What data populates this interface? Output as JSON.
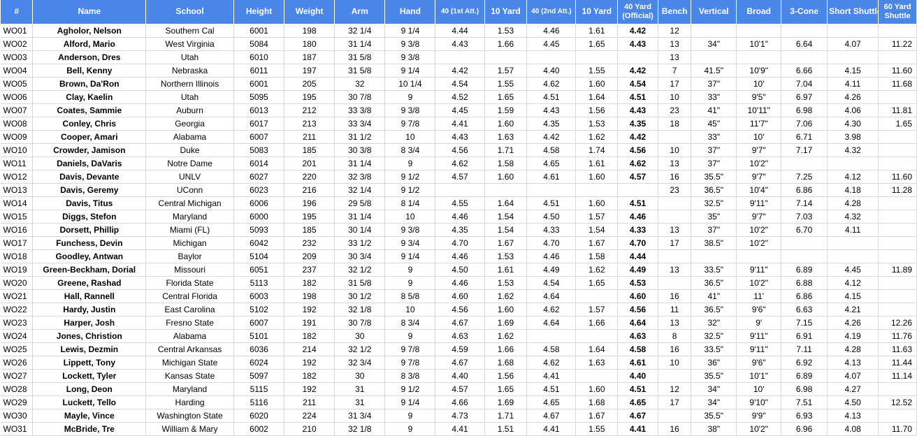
{
  "columns": [
    "#",
    "Name",
    "School",
    "Height",
    "Weight",
    "Arm",
    "Hand",
    "40 (1st Att.)",
    "10 Yard",
    "40 (2nd Att.)",
    "10 Yard",
    "40 Yard (Official)",
    "Bench",
    "Vertical",
    "Broad",
    "3-Cone",
    "Short Shuttle",
    "60 Yard Shuttle"
  ],
  "rows": [
    [
      "WO01",
      "Agholor, Nelson",
      "Southern Cal",
      "6001",
      "198",
      "32 1/4",
      "9 1/4",
      "4.44",
      "1.53",
      "4.46",
      "1.61",
      "4.42",
      "12",
      "",
      "",
      "",
      "",
      ""
    ],
    [
      "WO02",
      "Alford, Mario",
      "West Virginia",
      "5084",
      "180",
      "31 1/4",
      "9 3/8",
      "4.43",
      "1.66",
      "4.45",
      "1.65",
      "4.43",
      "13",
      "34\"",
      "10'1\"",
      "6.64",
      "4.07",
      "11.22"
    ],
    [
      "WO03",
      "Anderson, Dres",
      "Utah",
      "6010",
      "187",
      "31 5/8",
      "9 3/8",
      "",
      "",
      "",
      "",
      "",
      "13",
      "",
      "",
      "",
      "",
      ""
    ],
    [
      "WO04",
      "Bell, Kenny",
      "Nebraska",
      "6011",
      "197",
      "31 5/8",
      "9 1/4",
      "4.42",
      "1.57",
      "4.40",
      "1.55",
      "4.42",
      "7",
      "41.5\"",
      "10'9\"",
      "6.66",
      "4.15",
      "11.60"
    ],
    [
      "WO05",
      "Brown, Da'Ron",
      "Northern Illinois",
      "6001",
      "205",
      "32",
      "10 1/4",
      "4.54",
      "1.55",
      "4.62",
      "1.60",
      "4.54",
      "17",
      "37\"",
      "10'",
      "7.04",
      "4.11",
      "11.68"
    ],
    [
      "WO06",
      "Clay, Kaelin",
      "Utah",
      "5095",
      "195",
      "30 7/8",
      "9",
      "4.52",
      "1.65",
      "4.51",
      "1.64",
      "4.51",
      "10",
      "33\"",
      "9'5\"",
      "6.97",
      "4.26",
      ""
    ],
    [
      "WO07",
      "Coates, Sammie",
      "Auburn",
      "6013",
      "212",
      "33 3/8",
      "9 3/8",
      "4.45",
      "1.59",
      "4.43",
      "1.56",
      "4.43",
      "23",
      "41\"",
      "10'11\"",
      "6.98",
      "4.06",
      "11.81"
    ],
    [
      "WO08",
      "Conley, Chris",
      "Georgia",
      "6017",
      "213",
      "33 3/4",
      "9 7/8",
      "4.41",
      "1.60",
      "4.35",
      "1.53",
      "4.35",
      "18",
      "45\"",
      "11'7\"",
      "7.06",
      "4.30",
      "1.65"
    ],
    [
      "WO09",
      "Cooper, Amari",
      "Alabama",
      "6007",
      "211",
      "31 1/2",
      "10",
      "4.43",
      "1.63",
      "4.42",
      "1.62",
      "4.42",
      "",
      "33\"",
      "10'",
      "6.71",
      "3.98",
      ""
    ],
    [
      "WO10",
      "Crowder, Jamison",
      "Duke",
      "5083",
      "185",
      "30 3/8",
      "8 3/4",
      "4.56",
      "1.71",
      "4.58",
      "1.74",
      "4.56",
      "10",
      "37\"",
      "9'7\"",
      "7.17",
      "4.32",
      ""
    ],
    [
      "WO11",
      "Daniels, DaVaris",
      "Notre Dame",
      "6014",
      "201",
      "31 1/4",
      "9",
      "4.62",
      "1.58",
      "4.65",
      "1.61",
      "4.62",
      "13",
      "37\"",
      "10'2\"",
      "",
      "",
      ""
    ],
    [
      "WO12",
      "Davis, Devante",
      "UNLV",
      "6027",
      "220",
      "32 3/8",
      "9 1/2",
      "4.57",
      "1.60",
      "4.61",
      "1.60",
      "4.57",
      "16",
      "35.5\"",
      "9'7\"",
      "7.25",
      "4.12",
      "11.60"
    ],
    [
      "WO13",
      "Davis, Geremy",
      "UConn",
      "6023",
      "216",
      "32 1/4",
      "9 1/2",
      "",
      "",
      "",
      "",
      "",
      "23",
      "36.5\"",
      "10'4\"",
      "6.86",
      "4.18",
      "11.28"
    ],
    [
      "WO14",
      "Davis, Titus",
      "Central Michigan",
      "6006",
      "196",
      "29 5/8",
      "8 1/4",
      "4.55",
      "1.64",
      "4.51",
      "1.60",
      "4.51",
      "",
      "32.5\"",
      "9'11\"",
      "7.14",
      "4.28",
      ""
    ],
    [
      "WO15",
      "Diggs, Stefon",
      "Maryland",
      "6000",
      "195",
      "31 1/4",
      "10",
      "4.46",
      "1.54",
      "4.50",
      "1.57",
      "4.46",
      "",
      "35\"",
      "9'7\"",
      "7.03",
      "4.32",
      ""
    ],
    [
      "WO16",
      "Dorsett, Phillip",
      "Miami (FL)",
      "5093",
      "185",
      "30 1/4",
      "9 3/8",
      "4.35",
      "1.54",
      "4.33",
      "1.54",
      "4.33",
      "13",
      "37\"",
      "10'2\"",
      "6.70",
      "4.11",
      ""
    ],
    [
      "WO17",
      "Funchess, Devin",
      "Michigan",
      "6042",
      "232",
      "33 1/2",
      "9 3/4",
      "4.70",
      "1.67",
      "4.70",
      "1.67",
      "4.70",
      "17",
      "38.5\"",
      "10'2\"",
      "",
      "",
      ""
    ],
    [
      "WO18",
      "Goodley, Antwan",
      "Baylor",
      "5104",
      "209",
      "30 3/4",
      "9 1/4",
      "4.46",
      "1.53",
      "4.46",
      "1.58",
      "4.44",
      "",
      "",
      "",
      "",
      "",
      ""
    ],
    [
      "WO19",
      "Green-Beckham, Dorial",
      "Missouri",
      "6051",
      "237",
      "32 1/2",
      "9",
      "4.50",
      "1.61",
      "4.49",
      "1.62",
      "4.49",
      "13",
      "33.5\"",
      "9'11\"",
      "6.89",
      "4.45",
      "11.89"
    ],
    [
      "WO20",
      "Greene, Rashad",
      "Florida State",
      "5113",
      "182",
      "31 5/8",
      "9",
      "4.46",
      "1.53",
      "4.54",
      "1.65",
      "4.53",
      "",
      "36.5\"",
      "10'2\"",
      "6.88",
      "4.12",
      ""
    ],
    [
      "WO21",
      "Hall, Rannell",
      "Central Florida",
      "6003",
      "198",
      "30 1/2",
      "8 5/8",
      "4.60",
      "1.62",
      "4.64",
      "",
      "4.60",
      "16",
      "41\"",
      "11'",
      "6.86",
      "4.15",
      ""
    ],
    [
      "WO22",
      "Hardy, Justin",
      "East Carolina",
      "5102",
      "192",
      "32 1/8",
      "10",
      "4.56",
      "1.60",
      "4.62",
      "1.57",
      "4.56",
      "11",
      "36.5\"",
      "9'6\"",
      "6.63",
      "4.21",
      ""
    ],
    [
      "WO23",
      "Harper, Josh",
      "Fresno State",
      "6007",
      "191",
      "30 7/8",
      "8 3/4",
      "4.67",
      "1.69",
      "4.64",
      "1.66",
      "4.64",
      "13",
      "32\"",
      "9'",
      "7.15",
      "4.26",
      "12.26"
    ],
    [
      "WO24",
      "Jones, Christion",
      "Alabama",
      "5101",
      "182",
      "30",
      "9",
      "4.63",
      "1.62",
      "",
      "",
      "4.63",
      "8",
      "32.5\"",
      "9'11\"",
      "6.91",
      "4.19",
      "11.76"
    ],
    [
      "WO25",
      "Lewis, Dezmin",
      "Central Arkansas",
      "6036",
      "214",
      "32 1/2",
      "9 7/8",
      "4.59",
      "1.66",
      "4.58",
      "1.64",
      "4.58",
      "16",
      "33.5\"",
      "9'11\"",
      "7.11",
      "4.28",
      "11.63"
    ],
    [
      "WO26",
      "Lippett, Tony",
      "Michigan State",
      "6024",
      "192",
      "32 3/4",
      "9 7/8",
      "4.67",
      "1.68",
      "4.62",
      "1.63",
      "4.61",
      "10",
      "36\"",
      "9'6\"",
      "6.92",
      "4.13",
      "11.44"
    ],
    [
      "WO27",
      "Lockett, Tyler",
      "Kansas State",
      "5097",
      "182",
      "30",
      "8 3/8",
      "4.40",
      "1.56",
      "4.41",
      "",
      "4.40",
      "",
      "35.5\"",
      "10'1\"",
      "6.89",
      "4.07",
      "11.14"
    ],
    [
      "WO28",
      "Long, Deon",
      "Maryland",
      "5115",
      "192",
      "31",
      "9 1/2",
      "4.57",
      "1.65",
      "4.51",
      "1.60",
      "4.51",
      "12",
      "34\"",
      "10'",
      "6.98",
      "4.27",
      ""
    ],
    [
      "WO29",
      "Luckett, Tello",
      "Harding",
      "5116",
      "211",
      "31",
      "9 1/4",
      "4.66",
      "1.69",
      "4.65",
      "1.68",
      "4.65",
      "17",
      "34\"",
      "9'10\"",
      "7.51",
      "4.50",
      "12.52"
    ],
    [
      "WO30",
      "Mayle, Vince",
      "Washington State",
      "6020",
      "224",
      "31 3/4",
      "9",
      "4.73",
      "1.71",
      "4.67",
      "1.67",
      "4.67",
      "",
      "35.5\"",
      "9'9\"",
      "6.93",
      "4.13",
      ""
    ],
    [
      "WO31",
      "McBride, Tre",
      "William & Mary",
      "6002",
      "210",
      "32 1/8",
      "9",
      "4.41",
      "1.51",
      "4.41",
      "1.55",
      "4.41",
      "16",
      "38\"",
      "10'2\"",
      "6.96",
      "4.08",
      "11.70"
    ]
  ]
}
